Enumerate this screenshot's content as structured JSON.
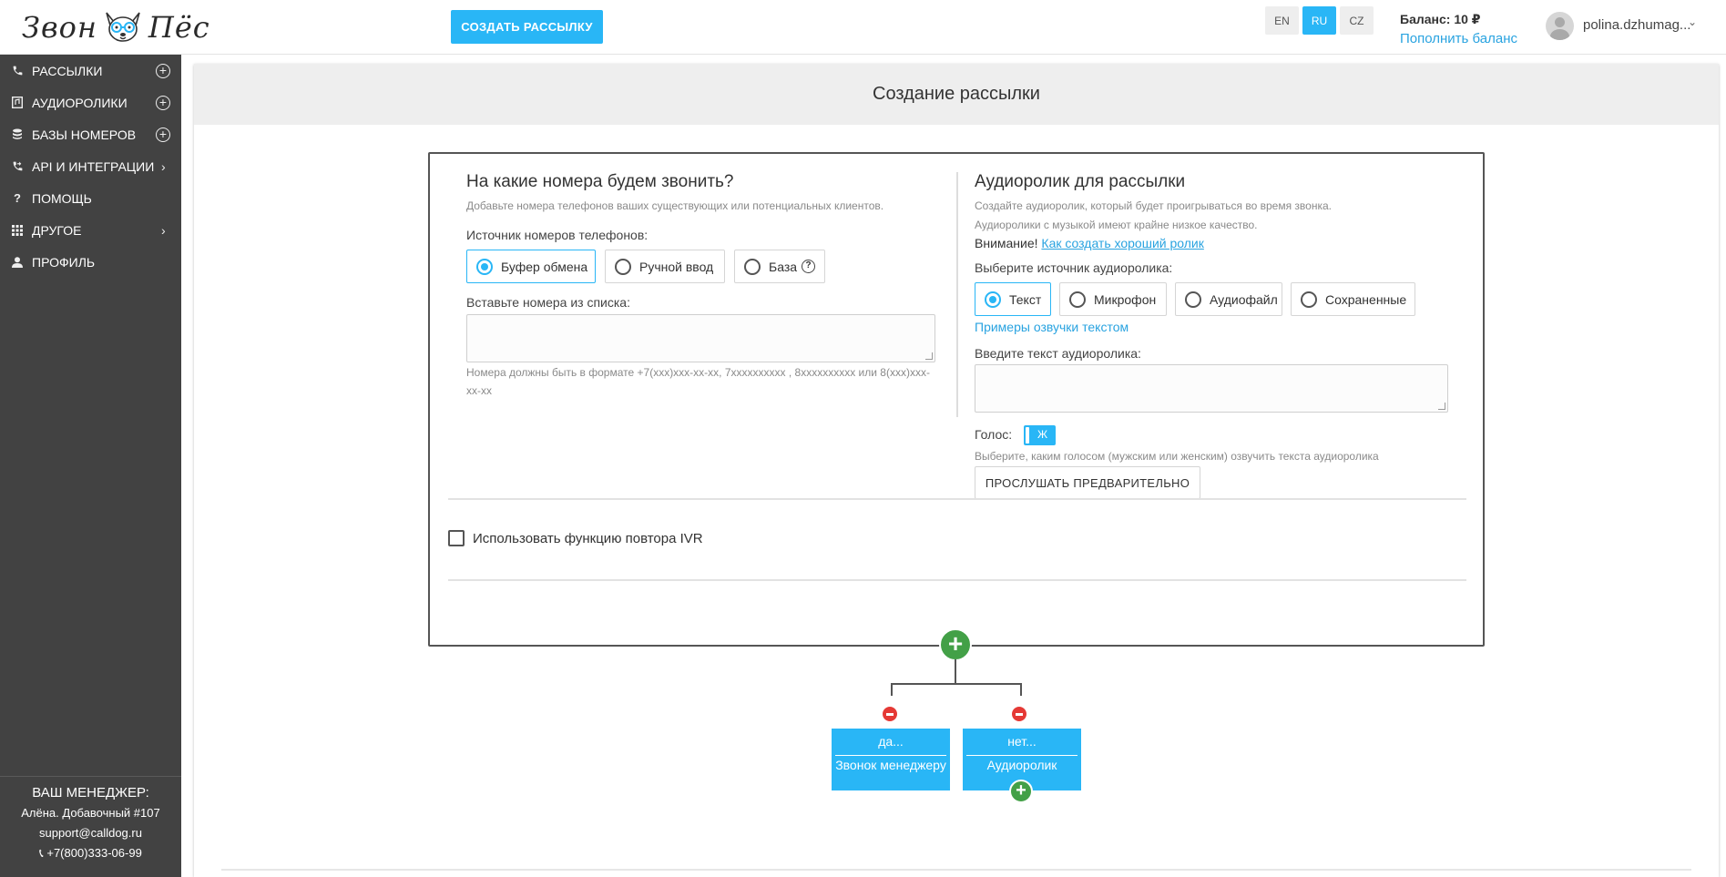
{
  "header": {
    "logo_left": "Звон",
    "logo_right": "Пёс",
    "create_button": "СОЗДАТЬ РАССЫЛКУ",
    "languages": [
      "EN",
      "RU",
      "CZ"
    ],
    "active_language": "RU",
    "balance": "Баланс: 10 ₽",
    "topup_link": "Пополнить баланс",
    "username": "polina.dzhumag..."
  },
  "sidebar": {
    "items": [
      {
        "label": "РАССЫЛКИ",
        "icon": "phone-icon",
        "trail": "plus"
      },
      {
        "label": "АУДИОРОЛИКИ",
        "icon": "audio-file-icon",
        "trail": "plus"
      },
      {
        "label": "БАЗЫ НОМЕРОВ",
        "icon": "database-icon",
        "trail": "plus"
      },
      {
        "label": "API И ИНТЕГРАЦИИ",
        "icon": "phone-forward-icon",
        "trail": "chevron"
      },
      {
        "label": "ПОМОЩЬ",
        "icon": "question-icon",
        "trail": ""
      },
      {
        "label": "ДРУГОЕ",
        "icon": "grid-icon",
        "trail": "chevron"
      },
      {
        "label": "ПРОФИЛЬ",
        "icon": "person-icon",
        "trail": ""
      }
    ],
    "manager": {
      "title": "ВАШ МЕНЕДЖЕР:",
      "name": "Алёна. Добавочный #107",
      "email": "support@calldog.ru",
      "phone": "+7(800)333-06-99"
    }
  },
  "main": {
    "title": "Создание рассылки",
    "left": {
      "heading": "На какие номера будем звонить?",
      "hint": "Добавьте номера телефонов ваших существующих или потенциальных клиентов.",
      "source_label": "Источник номеров телефонов:",
      "sources": [
        "Буфер обмена",
        "Ручной ввод",
        "База"
      ],
      "selected_source": "Буфер обмена",
      "paste_label": "Вставьте номера из списка:",
      "textarea_value": "",
      "format_hint": "Номера должны быть в формате +7(xxx)xxx-xx-xx, 7xxxxxxxxxx , 8xxxxxxxxxx или 8(xxx)xxx-xx-xx"
    },
    "right": {
      "heading": "Аудиоролик для рассылки",
      "hint1": "Создайте аудиоролик, который будет проигрываться во время звонка.",
      "hint2": "Аудиоролики с музыкой имеют крайне низкое качество.",
      "warning_prefix": "Внимание!",
      "warning_link": "Как создать хороший ролик",
      "source_label": "Выберите источник аудиоролика:",
      "sources": [
        "Текст",
        "Микрофон",
        "Аудиофайл",
        "Сохраненные"
      ],
      "selected_source": "Текст",
      "examples_link": "Примеры озвучки текстом",
      "text_label": "Введите текст аудиоролика:",
      "textarea_value": "",
      "voice_label": "Голос:",
      "voice_value": "Ж",
      "voice_hint": "Выберите, каким голосом (мужским или женским) озвучить текста аудиоролика",
      "preview_button": "ПРОСЛУШАТЬ ПРЕДВАРИТЕЛЬНО"
    },
    "ivr_checkbox_label": "Использовать функцию повтора IVR",
    "ivr_checked": false,
    "tree": {
      "nodes": [
        {
          "top": "да...",
          "bottom": "Звонок менеджеру"
        },
        {
          "top": "нет...",
          "bottom": "Аудиоролик"
        }
      ]
    }
  },
  "colors": {
    "accent": "#29b6f6",
    "sidebar_bg": "#424242",
    "add_green": "#43a047",
    "remove_red": "#e53935"
  }
}
